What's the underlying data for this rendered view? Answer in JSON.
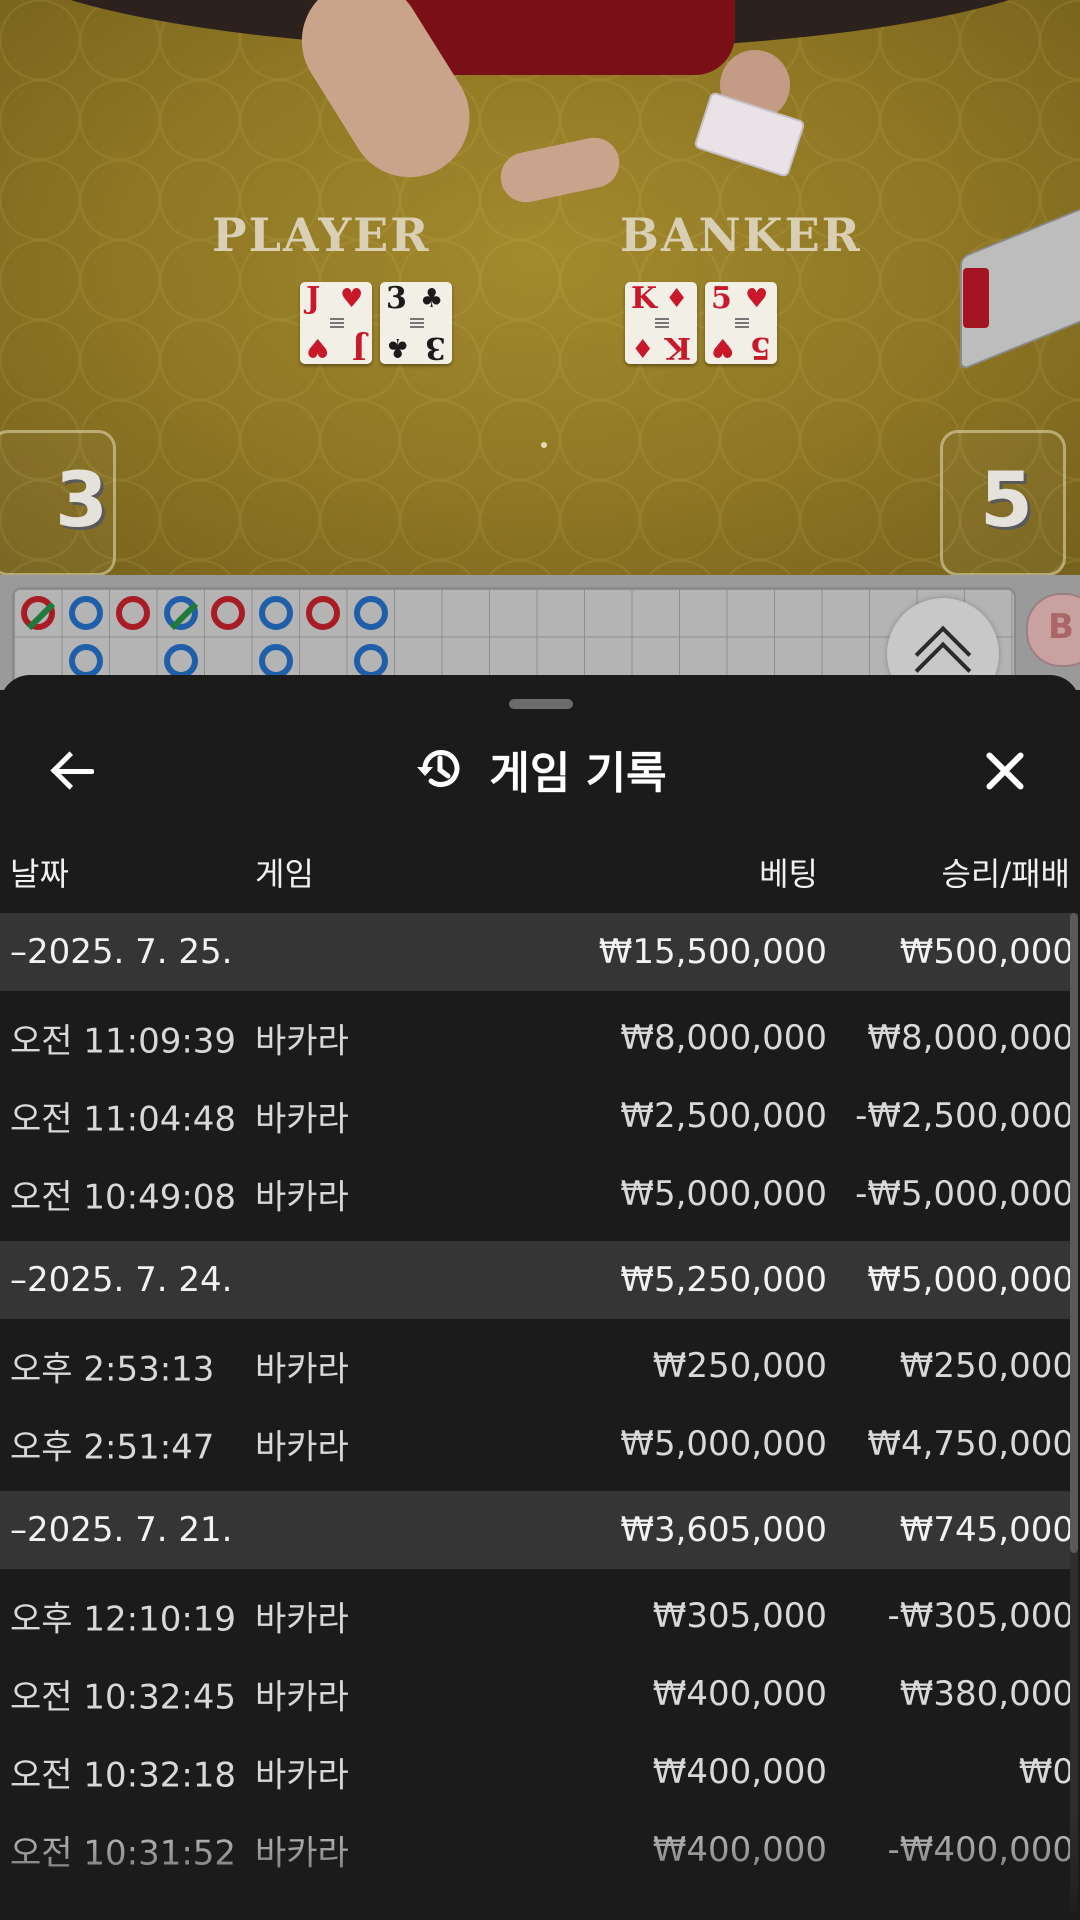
{
  "video": {
    "player_label": "PLAYER",
    "banker_label": "BANKER",
    "player_score": "3",
    "banker_score": "5",
    "player_cards": [
      {
        "rank": "J",
        "suit": "♥",
        "color": "red"
      },
      {
        "rank": "3",
        "suit": "♣",
        "color": "black"
      }
    ],
    "banker_cards": [
      {
        "rank": "K",
        "suit": "♦",
        "color": "red"
      },
      {
        "rank": "5",
        "suit": "♥",
        "color": "red"
      }
    ]
  },
  "bead_road": {
    "colors": {
      "banker": "#a81c25",
      "player": "#1f5ea8",
      "tie": "#1f7a3b"
    },
    "top_row": [
      "banker-tie",
      "player",
      "banker",
      "player-tie",
      "banker",
      "player",
      "banker",
      "player"
    ],
    "bottom_row": [
      "player",
      "player",
      "player",
      "player"
    ],
    "side_badge": "B"
  },
  "sheet": {
    "title": "게임 기록",
    "back_icon": "arrow-left-icon",
    "history_icon": "history-icon",
    "close_icon": "close-icon",
    "columns": {
      "date": "날짜",
      "game": "게임",
      "bet": "베팅",
      "win_loss": "승리/패배"
    },
    "groups": [
      {
        "date": "–2025. 7. 25.",
        "bet": "₩15,500,000",
        "win_loss": "₩500,000",
        "items": [
          {
            "time": "오전 11:09:39",
            "game": "바카라",
            "bet": "₩8,000,000",
            "win_loss": "₩8,000,000"
          },
          {
            "time": "오전 11:04:48",
            "game": "바카라",
            "bet": "₩2,500,000",
            "win_loss": "-₩2,500,000"
          },
          {
            "time": "오전 10:49:08",
            "game": "바카라",
            "bet": "₩5,000,000",
            "win_loss": "-₩5,000,000"
          }
        ]
      },
      {
        "date": "–2025. 7. 24.",
        "bet": "₩5,250,000",
        "win_loss": "₩5,000,000",
        "items": [
          {
            "time": "오후 2:53:13",
            "game": "바카라",
            "bet": "₩250,000",
            "win_loss": "₩250,000"
          },
          {
            "time": "오후 2:51:47",
            "game": "바카라",
            "bet": "₩5,000,000",
            "win_loss": "₩4,750,000"
          }
        ]
      },
      {
        "date": "–2025. 7. 21.",
        "bet": "₩3,605,000",
        "win_loss": "₩745,000",
        "items": [
          {
            "time": "오후 12:10:19",
            "game": "바카라",
            "bet": "₩305,000",
            "win_loss": "-₩305,000"
          },
          {
            "time": "오전 10:32:45",
            "game": "바카라",
            "bet": "₩400,000",
            "win_loss": "₩380,000"
          },
          {
            "time": "오전 10:32:18",
            "game": "바카라",
            "bet": "₩400,000",
            "win_loss": "₩0"
          },
          {
            "time": "오전 10:31:52",
            "game": "바카라",
            "bet": "₩400,000",
            "win_loss": "-₩400,000"
          }
        ]
      }
    ]
  }
}
